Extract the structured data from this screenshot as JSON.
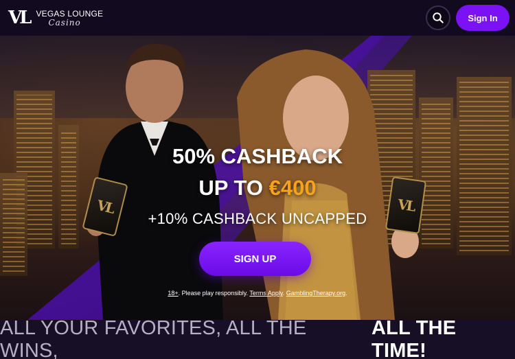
{
  "header": {
    "logo_mark": "VL",
    "logo_title": "VEGAS LOUNGE",
    "logo_subtitle": "Casino",
    "search_icon": "search-icon",
    "signin_label": "Sign In",
    "accent": "#7b11f5"
  },
  "hero": {
    "line1": "50% CASHBACK",
    "line2_prefix": "UP TO ",
    "line2_amount": "€400",
    "line3": "+10% CASHBACK UNCAPPED",
    "card_mark": "VL",
    "signup_label": "SIGN UP",
    "amount_color": "#f7a21b",
    "disclaimer": {
      "age": "18+",
      "text": ". Please play responsibly. ",
      "terms": "Terms Apply",
      "sep": ". ",
      "therapy": "GamblingTherapy.org",
      "end": "."
    }
  },
  "tagline": {
    "normal": "ALL YOUR FAVORITES, ALL THE WINS,",
    "strong": "ALL THE TIME!"
  }
}
